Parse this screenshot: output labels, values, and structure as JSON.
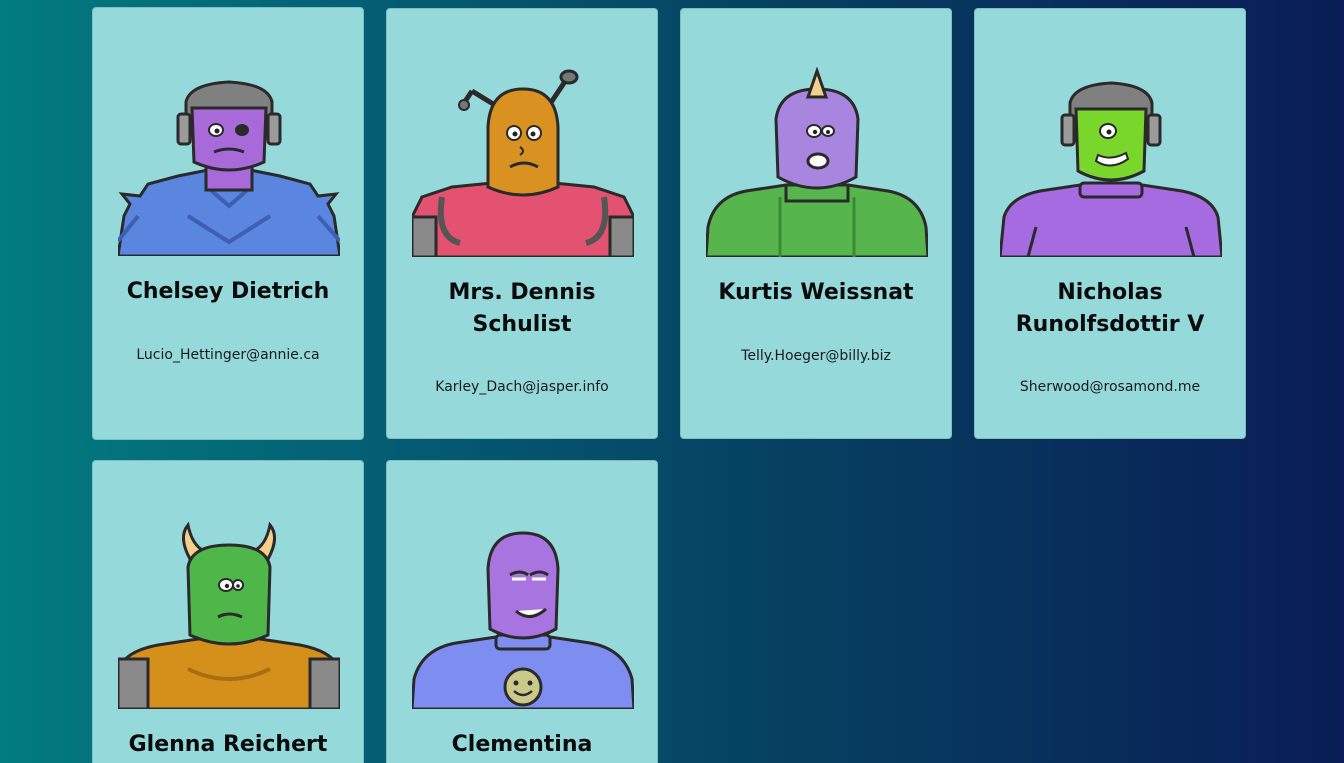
{
  "cards": [
    {
      "name": "Chelsey Dietrich",
      "email": "Lucio_Hettinger@annie.ca",
      "avatar": "robot-helmet-avatar-purple",
      "colors": {
        "skin": "#a86ad9",
        "body": "#5a86e0",
        "accent": "#4a6fc9"
      }
    },
    {
      "name": "Mrs. Dennis Schulist",
      "email": "Karley_Dach@jasper.info",
      "avatar": "antenna-alien-avatar-orange",
      "colors": {
        "skin": "#d99221",
        "body": "#e35270",
        "accent": "#bd3d5d"
      }
    },
    {
      "name": "Kurtis Weissnat",
      "email": "Telly.Hoeger@billy.biz",
      "avatar": "horned-cyclops-avatar-purple",
      "colors": {
        "skin": "#a886e0",
        "body": "#56b54c",
        "accent": "#3e9a38"
      }
    },
    {
      "name": "Nicholas Runolfsdottir V",
      "email": "Sherwood@rosamond.me",
      "avatar": "robot-helmet-avatar-green",
      "colors": {
        "skin": "#79d62a",
        "body": "#a66be0",
        "accent": "#8f54c9"
      }
    },
    {
      "name": "Glenna Reichert",
      "email": "",
      "avatar": "horned-alien-avatar-green",
      "colors": {
        "skin": "#4fb64a",
        "body": "#d4901b",
        "accent": "#b37613"
      }
    },
    {
      "name": "Clementina",
      "email": "",
      "avatar": "smiley-shirt-alien-avatar-purple",
      "colors": {
        "skin": "#a874e0",
        "body": "#7d8ef0",
        "accent": "#6676dd"
      }
    }
  ]
}
